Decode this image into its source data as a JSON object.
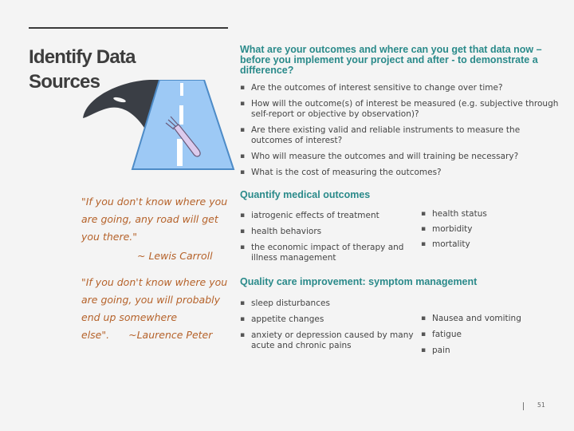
{
  "slide": {
    "title": "Identify Data Sources",
    "illustration": "road-with-fork-icon",
    "quotes": [
      {
        "text": "\"If you don't know where you are going, any road will get you there.\"",
        "attribution": "~ Lewis Carroll"
      },
      {
        "text": "\"If you don't know where you are going, you will probably end up somewhere else\".",
        "attribution": "~Laurence Peter"
      }
    ],
    "section1": {
      "heading": "What are your outcomes and where can you get that data now – before you implement your project and after - to demonstrate a difference?",
      "bullets": [
        "Are the outcomes of interest sensitive to change over time?",
        "How will the outcome(s) of interest be measured (e.g. subjective through self-report or objective by observation)?",
        "Are there existing valid and reliable instruments to measure the outcomes of interest?",
        "Who will measure the outcomes and will training be necessary?",
        "What is the cost of measuring the outcomes?"
      ]
    },
    "section2": {
      "heading": "Quantify medical outcomes",
      "left": [
        "iatrogenic effects of treatment",
        "health behaviors",
        "the economic impact of therapy and illness management"
      ],
      "right": [
        "health status",
        "morbidity",
        "mortality"
      ]
    },
    "section3": {
      "heading": "Quality care improvement: symptom management",
      "left": [
        "sleep disturbances",
        "appetite changes",
        "anxiety or depression caused by many acute and chronic pains"
      ],
      "right": [
        "Nausea and vomiting",
        "fatigue",
        "pain"
      ]
    },
    "page_number": "51"
  }
}
